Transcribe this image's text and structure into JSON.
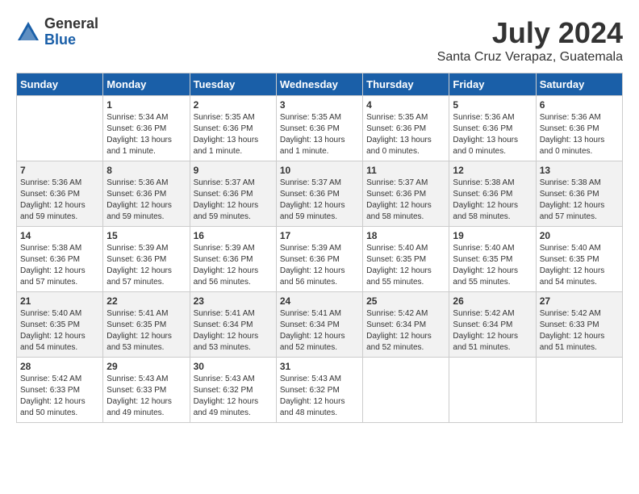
{
  "header": {
    "logo_general": "General",
    "logo_blue": "Blue",
    "month_title": "July 2024",
    "location": "Santa Cruz Verapaz, Guatemala"
  },
  "days_of_week": [
    "Sunday",
    "Monday",
    "Tuesday",
    "Wednesday",
    "Thursday",
    "Friday",
    "Saturday"
  ],
  "weeks": [
    [
      {
        "day": "",
        "sunrise": "",
        "sunset": "",
        "daylight": ""
      },
      {
        "day": "1",
        "sunrise": "Sunrise: 5:34 AM",
        "sunset": "Sunset: 6:36 PM",
        "daylight": "Daylight: 13 hours and 1 minute."
      },
      {
        "day": "2",
        "sunrise": "Sunrise: 5:35 AM",
        "sunset": "Sunset: 6:36 PM",
        "daylight": "Daylight: 13 hours and 1 minute."
      },
      {
        "day": "3",
        "sunrise": "Sunrise: 5:35 AM",
        "sunset": "Sunset: 6:36 PM",
        "daylight": "Daylight: 13 hours and 1 minute."
      },
      {
        "day": "4",
        "sunrise": "Sunrise: 5:35 AM",
        "sunset": "Sunset: 6:36 PM",
        "daylight": "Daylight: 13 hours and 0 minutes."
      },
      {
        "day": "5",
        "sunrise": "Sunrise: 5:36 AM",
        "sunset": "Sunset: 6:36 PM",
        "daylight": "Daylight: 13 hours and 0 minutes."
      },
      {
        "day": "6",
        "sunrise": "Sunrise: 5:36 AM",
        "sunset": "Sunset: 6:36 PM",
        "daylight": "Daylight: 13 hours and 0 minutes."
      }
    ],
    [
      {
        "day": "7",
        "sunrise": "Sunrise: 5:36 AM",
        "sunset": "Sunset: 6:36 PM",
        "daylight": "Daylight: 12 hours and 59 minutes."
      },
      {
        "day": "8",
        "sunrise": "Sunrise: 5:36 AM",
        "sunset": "Sunset: 6:36 PM",
        "daylight": "Daylight: 12 hours and 59 minutes."
      },
      {
        "day": "9",
        "sunrise": "Sunrise: 5:37 AM",
        "sunset": "Sunset: 6:36 PM",
        "daylight": "Daylight: 12 hours and 59 minutes."
      },
      {
        "day": "10",
        "sunrise": "Sunrise: 5:37 AM",
        "sunset": "Sunset: 6:36 PM",
        "daylight": "Daylight: 12 hours and 59 minutes."
      },
      {
        "day": "11",
        "sunrise": "Sunrise: 5:37 AM",
        "sunset": "Sunset: 6:36 PM",
        "daylight": "Daylight: 12 hours and 58 minutes."
      },
      {
        "day": "12",
        "sunrise": "Sunrise: 5:38 AM",
        "sunset": "Sunset: 6:36 PM",
        "daylight": "Daylight: 12 hours and 58 minutes."
      },
      {
        "day": "13",
        "sunrise": "Sunrise: 5:38 AM",
        "sunset": "Sunset: 6:36 PM",
        "daylight": "Daylight: 12 hours and 57 minutes."
      }
    ],
    [
      {
        "day": "14",
        "sunrise": "Sunrise: 5:38 AM",
        "sunset": "Sunset: 6:36 PM",
        "daylight": "Daylight: 12 hours and 57 minutes."
      },
      {
        "day": "15",
        "sunrise": "Sunrise: 5:39 AM",
        "sunset": "Sunset: 6:36 PM",
        "daylight": "Daylight: 12 hours and 57 minutes."
      },
      {
        "day": "16",
        "sunrise": "Sunrise: 5:39 AM",
        "sunset": "Sunset: 6:36 PM",
        "daylight": "Daylight: 12 hours and 56 minutes."
      },
      {
        "day": "17",
        "sunrise": "Sunrise: 5:39 AM",
        "sunset": "Sunset: 6:36 PM",
        "daylight": "Daylight: 12 hours and 56 minutes."
      },
      {
        "day": "18",
        "sunrise": "Sunrise: 5:40 AM",
        "sunset": "Sunset: 6:35 PM",
        "daylight": "Daylight: 12 hours and 55 minutes."
      },
      {
        "day": "19",
        "sunrise": "Sunrise: 5:40 AM",
        "sunset": "Sunset: 6:35 PM",
        "daylight": "Daylight: 12 hours and 55 minutes."
      },
      {
        "day": "20",
        "sunrise": "Sunrise: 5:40 AM",
        "sunset": "Sunset: 6:35 PM",
        "daylight": "Daylight: 12 hours and 54 minutes."
      }
    ],
    [
      {
        "day": "21",
        "sunrise": "Sunrise: 5:40 AM",
        "sunset": "Sunset: 6:35 PM",
        "daylight": "Daylight: 12 hours and 54 minutes."
      },
      {
        "day": "22",
        "sunrise": "Sunrise: 5:41 AM",
        "sunset": "Sunset: 6:35 PM",
        "daylight": "Daylight: 12 hours and 53 minutes."
      },
      {
        "day": "23",
        "sunrise": "Sunrise: 5:41 AM",
        "sunset": "Sunset: 6:34 PM",
        "daylight": "Daylight: 12 hours and 53 minutes."
      },
      {
        "day": "24",
        "sunrise": "Sunrise: 5:41 AM",
        "sunset": "Sunset: 6:34 PM",
        "daylight": "Daylight: 12 hours and 52 minutes."
      },
      {
        "day": "25",
        "sunrise": "Sunrise: 5:42 AM",
        "sunset": "Sunset: 6:34 PM",
        "daylight": "Daylight: 12 hours and 52 minutes."
      },
      {
        "day": "26",
        "sunrise": "Sunrise: 5:42 AM",
        "sunset": "Sunset: 6:34 PM",
        "daylight": "Daylight: 12 hours and 51 minutes."
      },
      {
        "day": "27",
        "sunrise": "Sunrise: 5:42 AM",
        "sunset": "Sunset: 6:33 PM",
        "daylight": "Daylight: 12 hours and 51 minutes."
      }
    ],
    [
      {
        "day": "28",
        "sunrise": "Sunrise: 5:42 AM",
        "sunset": "Sunset: 6:33 PM",
        "daylight": "Daylight: 12 hours and 50 minutes."
      },
      {
        "day": "29",
        "sunrise": "Sunrise: 5:43 AM",
        "sunset": "Sunset: 6:33 PM",
        "daylight": "Daylight: 12 hours and 49 minutes."
      },
      {
        "day": "30",
        "sunrise": "Sunrise: 5:43 AM",
        "sunset": "Sunset: 6:32 PM",
        "daylight": "Daylight: 12 hours and 49 minutes."
      },
      {
        "day": "31",
        "sunrise": "Sunrise: 5:43 AM",
        "sunset": "Sunset: 6:32 PM",
        "daylight": "Daylight: 12 hours and 48 minutes."
      },
      {
        "day": "",
        "sunrise": "",
        "sunset": "",
        "daylight": ""
      },
      {
        "day": "",
        "sunrise": "",
        "sunset": "",
        "daylight": ""
      },
      {
        "day": "",
        "sunrise": "",
        "sunset": "",
        "daylight": ""
      }
    ]
  ]
}
